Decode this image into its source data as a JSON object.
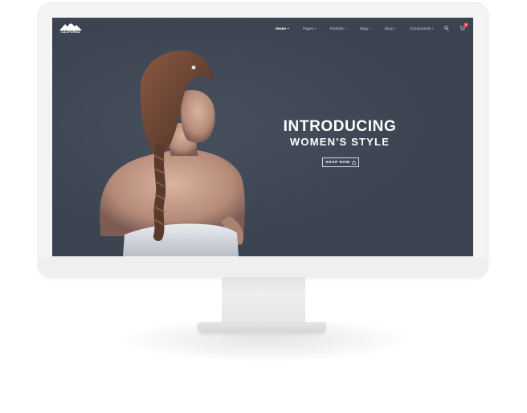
{
  "logo": {
    "text": "CALIFORNIA",
    "icon": "mountain-logo-icon"
  },
  "nav": {
    "items": [
      {
        "label": "Home",
        "suffix": "+",
        "active": true
      },
      {
        "label": "Pages",
        "suffix": "+",
        "active": false
      },
      {
        "label": "Portfolio",
        "suffix": "+",
        "active": false
      },
      {
        "label": "Blog",
        "suffix": "+",
        "active": false
      },
      {
        "label": "Shop",
        "suffix": "+",
        "active": false
      },
      {
        "label": "Components",
        "suffix": "+",
        "active": false
      }
    ],
    "search_icon": "search-icon",
    "cart_icon": "cart-icon",
    "cart_count": "0"
  },
  "hero": {
    "title": "INTRODUCING",
    "subtitle": "WOMEN'S STYLE",
    "button_label": "SHOP NOW",
    "button_icon": "shopping-bag-icon"
  },
  "colors": {
    "screen_background": "#3c4452",
    "badge": "#e63b4c",
    "text": "#ffffff",
    "device_frame": "#f4f4f5"
  }
}
